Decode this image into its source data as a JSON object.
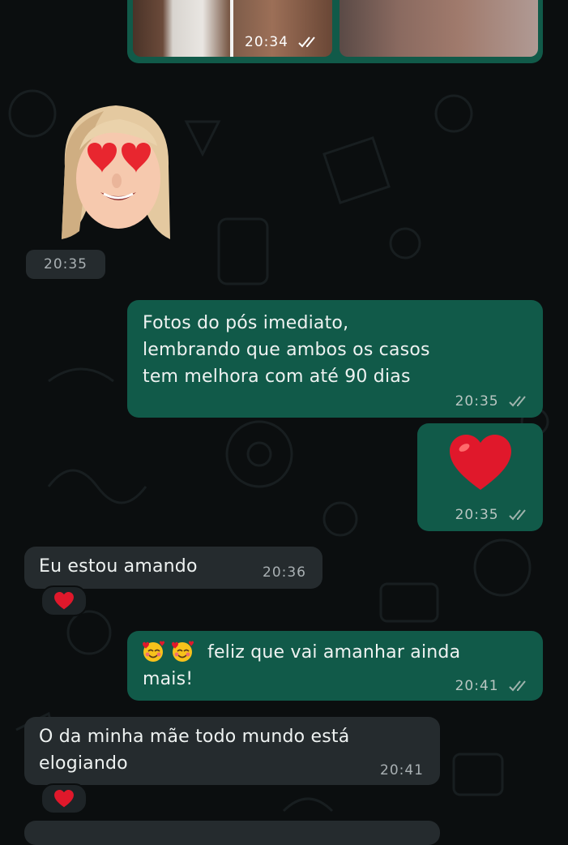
{
  "chat": {
    "photo_row": {
      "time": "20:34"
    },
    "memoji_sticker": {
      "time": "20:35"
    },
    "messages": [
      {
        "text_lines": [
          "Fotos do pós imediato,",
          "lembrando que ambos os casos",
          "tem melhora com até 90 dias"
        ],
        "time": "20:35",
        "direction": "outgoing"
      },
      {
        "time": "20:35",
        "direction": "outgoing"
      },
      {
        "text": "Eu estou amando",
        "time": "20:36",
        "direction": "incoming"
      },
      {
        "text_lines": [
          "feliz que vai amanhar ainda",
          "mais!"
        ],
        "time": "20:41",
        "direction": "outgoing"
      },
      {
        "text_lines": [
          "O da minha mãe todo mundo está",
          "elogiando"
        ],
        "time": "20:41",
        "direction": "incoming"
      }
    ]
  },
  "colors": {
    "outgoing_bubble": "#115a49",
    "incoming_bubble": "#252b2e",
    "background": "#0b0e0f",
    "read_ticks": "#9fb3ad",
    "heart": "#e0182b"
  },
  "icons": [
    "double-check-icon",
    "heart-emoji-icon",
    "smiling-hearts-emoji-icon",
    "memoji-heart-eyes-sticker"
  ]
}
